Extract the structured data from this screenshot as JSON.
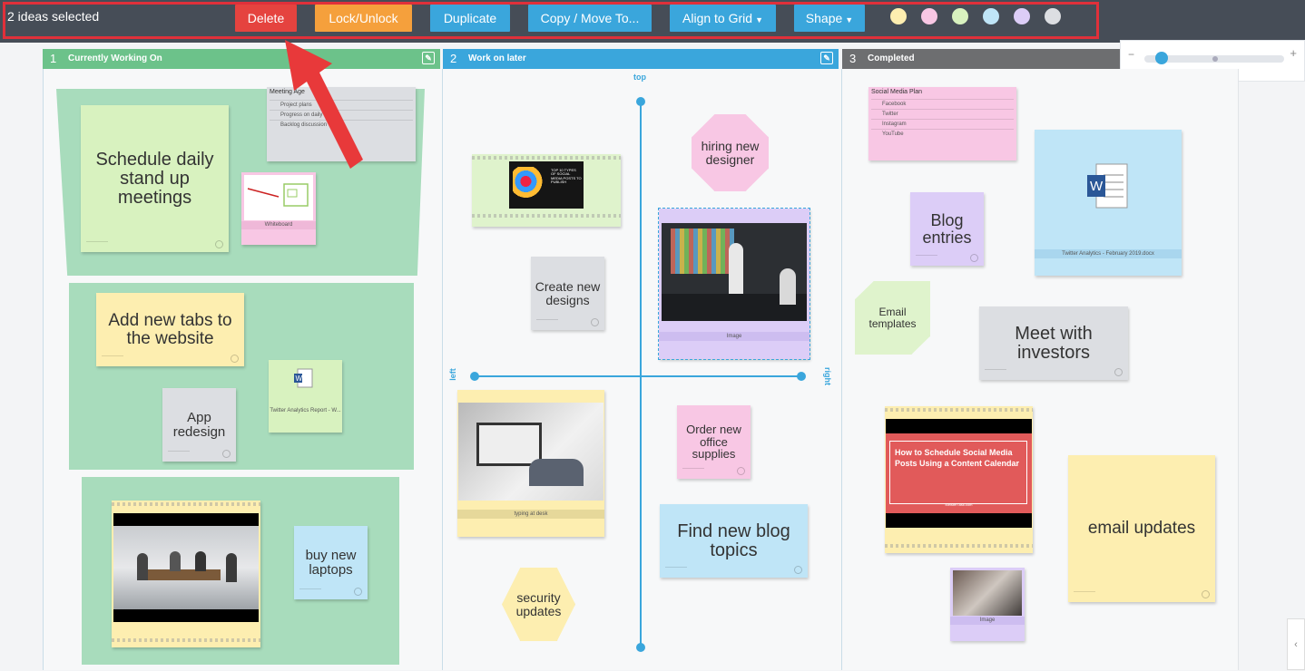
{
  "toolbar": {
    "selection_label": "2 ideas selected",
    "buttons": [
      {
        "label": "Delete",
        "color": "#e5433f"
      },
      {
        "label": "Lock/Unlock",
        "color": "#f5a03c"
      },
      {
        "label": "Duplicate",
        "color": "#3aa6dc"
      },
      {
        "label": "Copy / Move To...",
        "color": "#3aa6dc"
      },
      {
        "label": "Align to Grid",
        "color": "#3aa6dc"
      },
      {
        "label": "Shape",
        "color": "#3aa6dc"
      }
    ],
    "swatches": [
      "#fdeeb0",
      "#f8c7e4",
      "#d8f2bf",
      "#bfe5f7",
      "#dccdf7",
      "#dcdee2"
    ]
  },
  "zoom": {
    "minus": "−",
    "plus": "+",
    "level": 0.1
  },
  "columns": [
    {
      "num": "1",
      "title": "Currently Working On",
      "color": "#6cc28a"
    },
    {
      "num": "2",
      "title": "Work on later",
      "color": "#3aa6dc"
    },
    {
      "num": "3",
      "title": "Completed",
      "color": "#6d6e70"
    }
  ],
  "axis": {
    "top": "top",
    "left": "left",
    "right": "right"
  },
  "col1": {
    "note_schedule": "Schedule daily stand up meetings",
    "meeting_list_title": "Meeting Age",
    "meeting_items": [
      "Project plans",
      "Progress on daily tasks",
      "Backlog discussion"
    ],
    "whiteboard_caption": "Whiteboard",
    "note_tabs": "Add new tabs to the website",
    "note_app": "App redesign",
    "doc_caption": "Twitter Analytics Report - W...",
    "note_laptops": "buy new laptops"
  },
  "col2": {
    "social_img_text": "TOP 10 TYPES OF SOCIAL MEDIA POSTS TO PUBLISH",
    "note_hiring": "hiring new designer",
    "note_designs": "Create new designs",
    "office_caption": "Image",
    "desk_caption": "typing at desk",
    "note_supplies": "Order new office supplies",
    "note_blog": "Find new blog topics",
    "note_security": "security updates"
  },
  "col3": {
    "social_list_title": "Social Media Plan",
    "social_items": [
      "Facebook",
      "Twitter",
      "Instagram",
      "YouTube"
    ],
    "note_blog_entries": "Blog entries",
    "word_caption": "Twitter Analytics - February 2019.docx",
    "note_email_templates": "Email templates",
    "note_investors": "Meet with investors",
    "video_title": "How to Schedule Social Media Posts Using a Content Calendar",
    "video_site": "MeisterTask.com",
    "note_email_updates": "email updates",
    "small_caption": "Image"
  }
}
